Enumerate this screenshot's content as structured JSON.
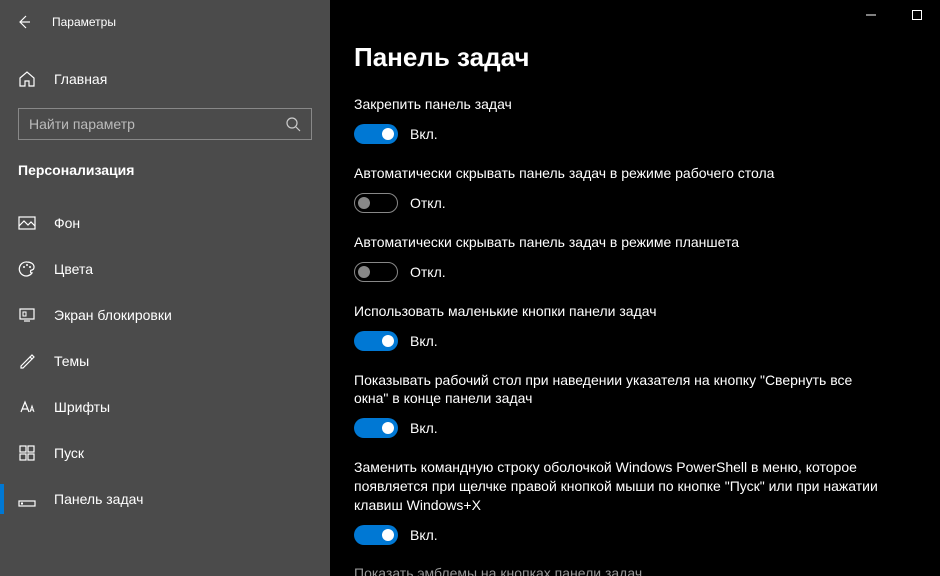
{
  "window": {
    "title": "Параметры"
  },
  "sidebar": {
    "home": "Главная",
    "search_placeholder": "Найти параметр",
    "section": "Персонализация",
    "items": [
      {
        "label": "Фон"
      },
      {
        "label": "Цвета"
      },
      {
        "label": "Экран блокировки"
      },
      {
        "label": "Темы"
      },
      {
        "label": "Шрифты"
      },
      {
        "label": "Пуск"
      },
      {
        "label": "Панель задач"
      }
    ]
  },
  "main": {
    "title": "Панель задач",
    "on": "Вкл.",
    "off": "Откл.",
    "settings": [
      {
        "label": "Закрепить панель задач",
        "state": true
      },
      {
        "label": "Автоматически скрывать панель задач в режиме рабочего стола",
        "state": false
      },
      {
        "label": "Автоматически скрывать панель задач в режиме планшета",
        "state": false
      },
      {
        "label": "Использовать маленькие кнопки панели задач",
        "state": true
      },
      {
        "label": "Показывать рабочий стол при наведении указателя на кнопку \"Свернуть все окна\" в конце панели задач",
        "state": true
      },
      {
        "label": "Заменить командную строку оболочкой Windows PowerShell в меню, которое появляется при щелчке правой кнопкой мыши по кнопке \"Пуск\" или при нажатии клавиш Windows+X",
        "state": true
      }
    ],
    "footer": "Показать эмблемы на кнопках панели задач"
  }
}
